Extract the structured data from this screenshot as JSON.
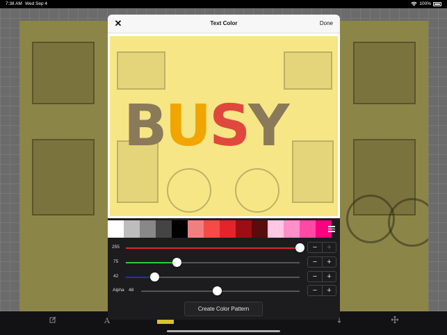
{
  "statusbar": {
    "time": "7:38 AM",
    "date": "Wed Sep 4",
    "battery": "100%",
    "wifi_icon": "wifi-icon",
    "battery_icon": "battery-icon"
  },
  "modal": {
    "title": "Text Color",
    "close_label": "✕",
    "done_label": "Done"
  },
  "preview": {
    "letters": [
      "B",
      "U",
      "S",
      "Y"
    ]
  },
  "swatches": [
    "#ffffff",
    "#bdbdbd",
    "#888888",
    "#444444",
    "#000000",
    "#f08080",
    "#f44b47",
    "#e3242b",
    "#9b0f12",
    "#5a0b0d",
    "#ffc7e4",
    "#ff8fc8",
    "#ff4aa3",
    "#ff007f"
  ],
  "sliders": [
    {
      "label": "",
      "value": "255",
      "fraction": 1.0,
      "color": "#e3242b",
      "minus": "−",
      "plus": "+",
      "plus_disabled": true
    },
    {
      "label": "",
      "value": "75",
      "fraction": 0.294,
      "color": "#2ecc40",
      "minus": "−",
      "plus": "+",
      "plus_disabled": false
    },
    {
      "label": "",
      "value": "42",
      "fraction": 0.165,
      "color": "#1e2bd6",
      "minus": "−",
      "plus": "+",
      "plus_disabled": false
    },
    {
      "label": "Alpha",
      "value": "48",
      "fraction": 0.48,
      "color": "#555555",
      "minus": "−",
      "plus": "+",
      "plus_disabled": false
    }
  ],
  "create_pattern_label": "Create Color Pattern",
  "toolbar": {
    "tools": [
      "edit-icon",
      "text-icon",
      "color-tool",
      "layers-icon",
      "effects-icon",
      "shadow-icon",
      "move-icon"
    ]
  },
  "colors": {
    "preview_bg": "#f6e685",
    "accent": "#d9c42b"
  }
}
